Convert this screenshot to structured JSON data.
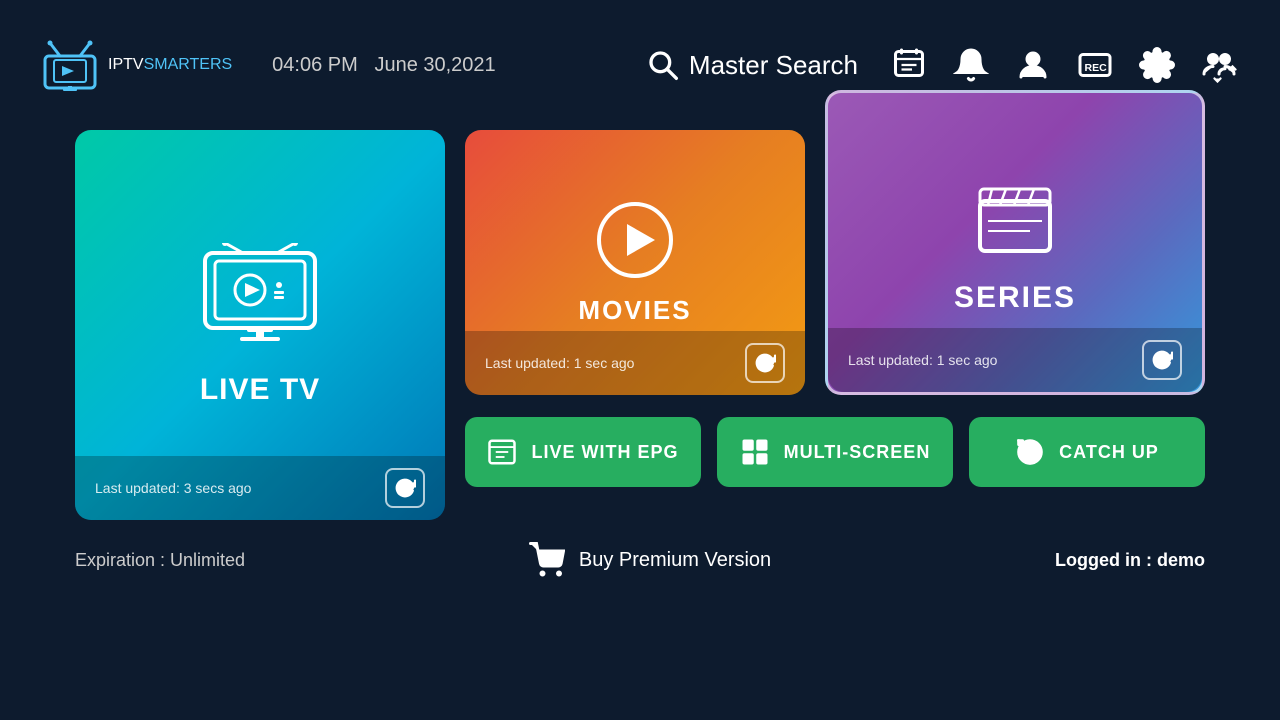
{
  "header": {
    "logo_iptv": "IPTV",
    "logo_smarters": "SMARTERS",
    "time": "04:06 PM",
    "date": "June 30,2021",
    "search_label": "Master Search",
    "icons": [
      "epg-icon",
      "notification-icon",
      "profile-icon",
      "record-icon",
      "settings-icon",
      "switch-profile-icon"
    ]
  },
  "cards": {
    "live_tv": {
      "label": "LIVE TV",
      "update_text": "Last updated: 3 secs ago"
    },
    "movies": {
      "label": "MOVIES",
      "update_text": "Last updated: 1 sec ago"
    },
    "series": {
      "label": "SERIES",
      "update_text": "Last updated: 1 sec ago"
    }
  },
  "action_buttons": {
    "live_epg": "LIVE WITH EPG",
    "multi_screen": "MULTI-SCREEN",
    "catch_up": "CATCH UP"
  },
  "footer": {
    "expiration": "Expiration : Unlimited",
    "buy_premium": "Buy Premium Version",
    "logged_in_label": "Logged in :",
    "logged_in_user": "demo"
  }
}
